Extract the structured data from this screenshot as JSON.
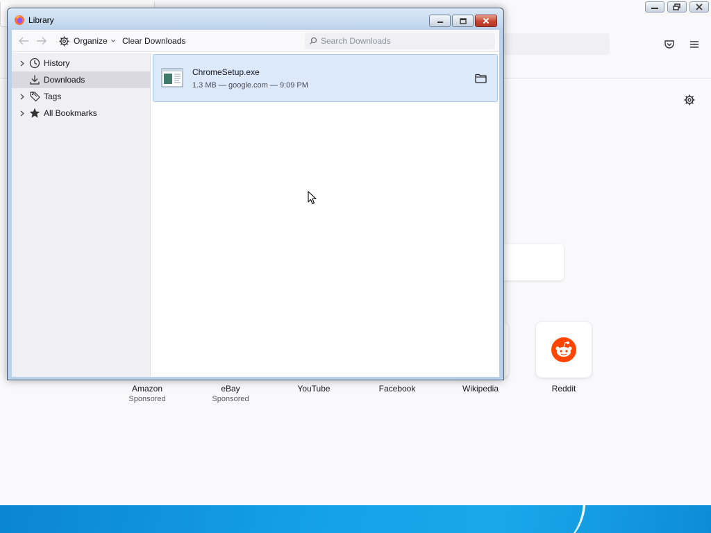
{
  "browser": {
    "new_tab_settings_icon": "gear-icon",
    "pocket_icon": "pocket-icon",
    "menu_icon": "hamburger-menu-icon",
    "top_sites": [
      {
        "label": "Amazon",
        "sub": "Sponsored"
      },
      {
        "label": "eBay",
        "sub": "Sponsored"
      },
      {
        "label": "YouTube",
        "sub": ""
      },
      {
        "label": "Facebook",
        "sub": ""
      },
      {
        "label": "Wikipedia",
        "sub": ""
      },
      {
        "label": "Reddit",
        "sub": ""
      }
    ],
    "reddit_color": "#ff4500"
  },
  "library": {
    "title": "Library",
    "toolbar": {
      "organize_label": "Organize",
      "clear_downloads_label": "Clear Downloads",
      "search_placeholder": "Search Downloads",
      "search_value": ""
    },
    "sidebar": {
      "items": [
        {
          "label": "History",
          "icon": "clock-icon",
          "expandable": true,
          "selected": false
        },
        {
          "label": "Downloads",
          "icon": "download-icon",
          "expandable": false,
          "selected": true
        },
        {
          "label": "Tags",
          "icon": "tag-icon",
          "expandable": true,
          "selected": false
        },
        {
          "label": "All Bookmarks",
          "icon": "star-icon",
          "expandable": true,
          "selected": false
        }
      ]
    },
    "downloads": [
      {
        "name": "ChromeSetup.exe",
        "meta": "1.3 MB — google.com — 9:09 PM",
        "action_icon": "folder-icon"
      }
    ],
    "colors": {
      "selected_item_bg": "#dbe9fb",
      "sidebar_bg": "#f0f0f4",
      "close_button": "#c7442f"
    }
  }
}
